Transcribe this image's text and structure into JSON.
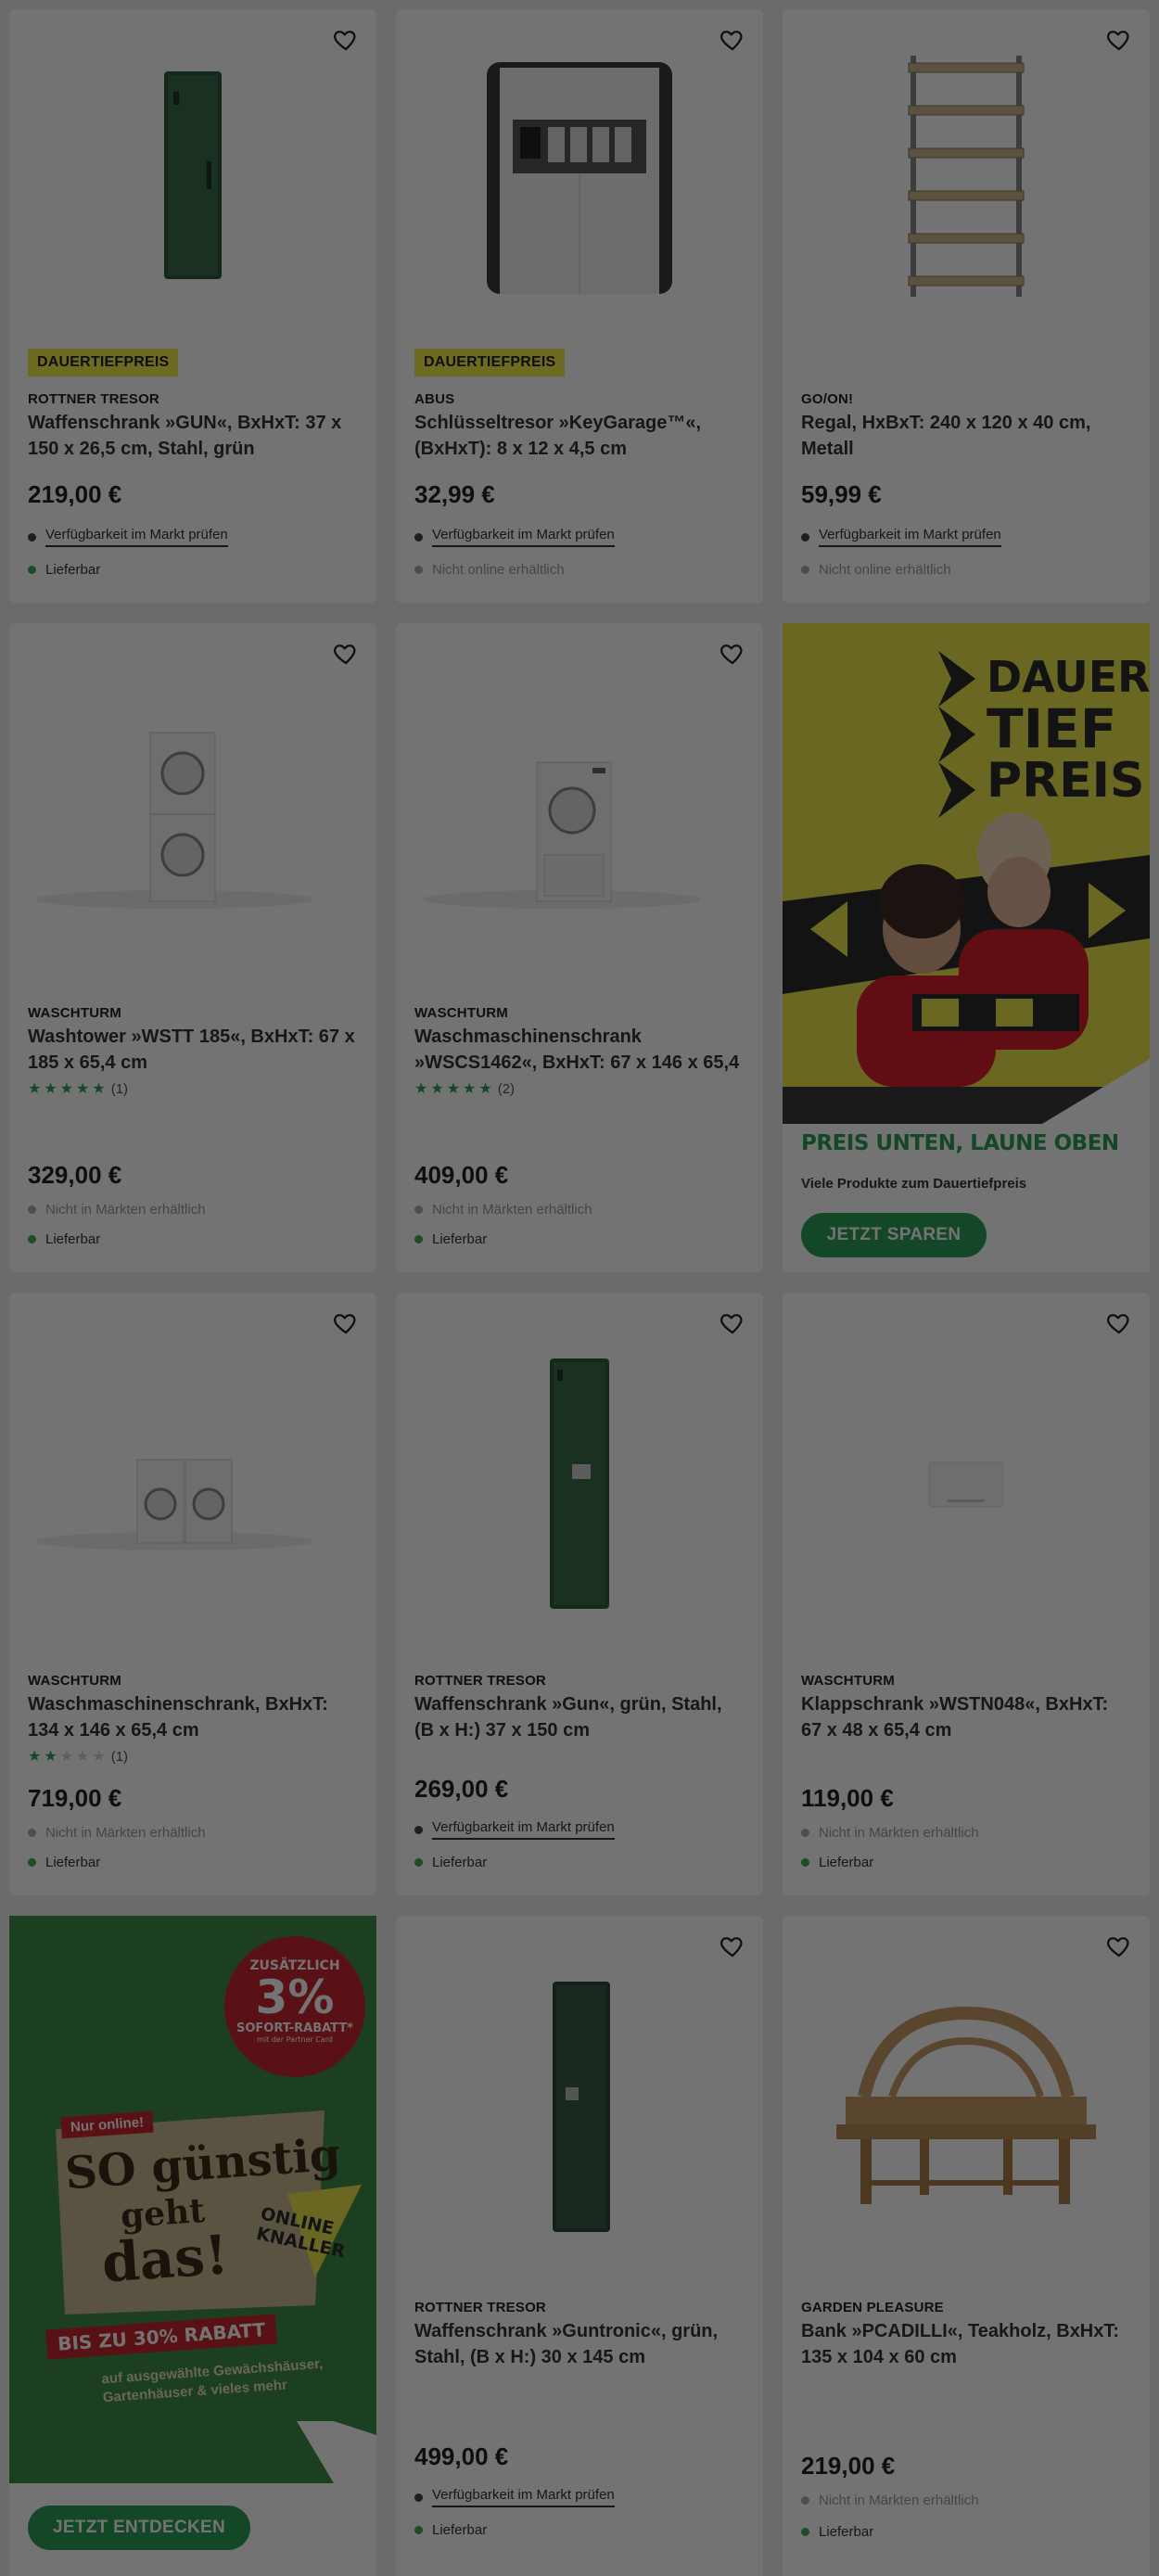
{
  "products": [
    {
      "badge": "DAUERTIEFPREIS",
      "brand": "ROTTNER TRESOR",
      "title": "Waffenschrank »GUN«, BxHxT: 37 x 150 x 26,5 cm, Stahl, grün",
      "price": "219,00 €",
      "avail1": "Verfügbarkeit im Markt prüfen",
      "avail2": "Lieferbar"
    },
    {
      "badge": "DAUERTIEFPREIS",
      "brand": "ABUS",
      "title": "Schlüsseltresor »KeyGarage™«, (BxHxT): 8 x 12 x 4,5 cm",
      "price": "32,99 €",
      "avail1": "Verfügbarkeit im Markt prüfen",
      "avail2": "Nicht online erhältlich"
    },
    {
      "brand": "GO/ON!",
      "title": "Regal, HxBxT: 240 x 120 x 40 cm, Metall",
      "price": "59,99 €",
      "avail1": "Verfügbarkeit im Markt prüfen",
      "avail2": "Nicht online erhältlich"
    },
    {
      "brand": "WASCHTURM",
      "title": "Washtower »WSTT 185«, BxHxT: 67 x 185 x 65,4 cm",
      "rating": 5,
      "reviews": "(1)",
      "price": "329,00 €",
      "avail1": "Nicht in Märkten erhältlich",
      "avail2": "Lieferbar"
    },
    {
      "brand": "WASCHTURM",
      "title": "Waschmaschinenschrank »WSCS1462«, BxHxT: 67 x 146 x 65,4 cm",
      "rating": 5,
      "reviews": "(2)",
      "price": "409,00 €",
      "avail1": "Nicht in Märkten erhältlich",
      "avail2": "Lieferbar"
    },
    {
      "brand": "WASCHTURM",
      "title": "Waschmaschinenschrank, BxHxT: 134 x 146 x 65,4 cm",
      "rating": 2,
      "reviews": "(1)",
      "price": "719,00 €",
      "avail1": "Nicht in Märkten erhältlich",
      "avail2": "Lieferbar"
    },
    {
      "brand": "ROTTNER TRESOR",
      "title": "Waffenschrank »Gun«, grün, Stahl, (B x H:) 37 x 150 cm",
      "price": "269,00 €",
      "avail1": "Verfügbarkeit im Markt prüfen",
      "avail2": "Lieferbar"
    },
    {
      "brand": "WASCHTURM",
      "title": "Klappschrank »WSTN048«, BxHxT: 67 x 48 x 65,4 cm",
      "price": "119,00 €",
      "avail1": "Nicht in Märkten erhältlich",
      "avail2": "Lieferbar"
    },
    {
      "brand": "ROTTNER TRESOR",
      "title": "Waffenschrank »Guntronic«, grün, Stahl, (B x H:) 30 x 145 cm",
      "price": "499,00 €",
      "avail1": "Verfügbarkeit im Markt prüfen",
      "avail2": "Lieferbar"
    },
    {
      "brand": "GARDEN PLEASURE",
      "title": "Bank »PCADILLI«, Teakholz, BxHxT: 135 x 104 x 60 cm",
      "price": "219,00 €",
      "avail1": "Nicht in Märkten erhältlich",
      "avail2": "Lieferbar"
    }
  ],
  "banner_dauertiefpreis": {
    "logo_line1": "DAUER",
    "logo_line2": "TIEF",
    "logo_line3": "PREIS",
    "headline": "PREIS UNTEN, LAUNE OBEN",
    "subtext": "Viele Produkte zum Dauertiefpreis",
    "button": "JETZT SPAREN"
  },
  "banner_online": {
    "stamp_top": "ZUSÄTZLICH",
    "stamp_value": "3%",
    "stamp_label": "SOFORT-RABATT*",
    "stamp_small": "mit der Partner Card",
    "tag": "Nur online!",
    "line1": "SO günstig",
    "line2": "geht",
    "line3": "das!",
    "knaller1": "ONLINE",
    "knaller2": "KNALLER",
    "discount": "BIS ZU 30% RABATT",
    "note1": "auf ausgewählte Gewächshäuser,",
    "note2": "Gartenhäuser & vieles mehr",
    "button": "JETZT ENTDECKEN"
  },
  "colors": {
    "badge": "#f2ec4b",
    "green_button": "#2c9e57",
    "banner_yellow": "#e8e54a",
    "banner_green": "#3f8a4b",
    "stamp_red": "#c8262f"
  }
}
